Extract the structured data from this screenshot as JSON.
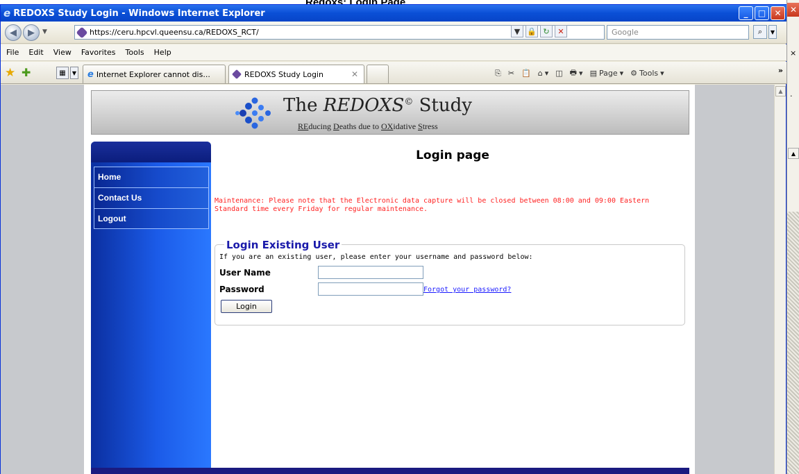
{
  "caption": "Redoxs: Login Page",
  "window": {
    "title": "REDOXS Study Login - Windows Internet Explorer",
    "buttons": {
      "minimize": "_",
      "maximize": "□",
      "close": "✕"
    }
  },
  "addressbar": {
    "url": "https://ceru.hpcvl.queensu.ca/REDOXS_RCT/",
    "search_placeholder": "Google"
  },
  "menu": [
    "File",
    "Edit",
    "View",
    "Favorites",
    "Tools",
    "Help"
  ],
  "tabs": [
    {
      "label": "Internet Explorer cannot dis...",
      "active": false
    },
    {
      "label": "REDOXS Study Login",
      "active": true
    }
  ],
  "commandbar": {
    "page": "Page",
    "tools": "Tools"
  },
  "banner": {
    "the": "The",
    "name": "REDOXS",
    "copyright": "©",
    "study": "Study",
    "subtitle_parts": [
      "RE",
      "ducing ",
      "D",
      "eaths due to ",
      "OX",
      "idative ",
      "S",
      "tress"
    ]
  },
  "sidebar": {
    "items": [
      "Home",
      "Contact Us",
      "Logout"
    ]
  },
  "main": {
    "title": "Login page",
    "maintenance_line1": "Maintenance: Please note that the Electronic data capture will be closed between 08:00 and 09:00 Eastern",
    "maintenance_line2": "Standard time every Friday for regular maintenance.",
    "login": {
      "legend": "Login Existing User",
      "intro": "If you are an existing user, please enter your username and password below:",
      "username_label": "User Name",
      "username_value": "",
      "password_label": "Password",
      "password_value": "",
      "forgot_link": "Forgot your password?",
      "button_label": "Login"
    }
  },
  "colors": {
    "sidebar": "#1b5be8",
    "maintenance_text": "#ff1f1f",
    "legend": "#1a1aaa",
    "titlebar": "#0a4fd6"
  }
}
